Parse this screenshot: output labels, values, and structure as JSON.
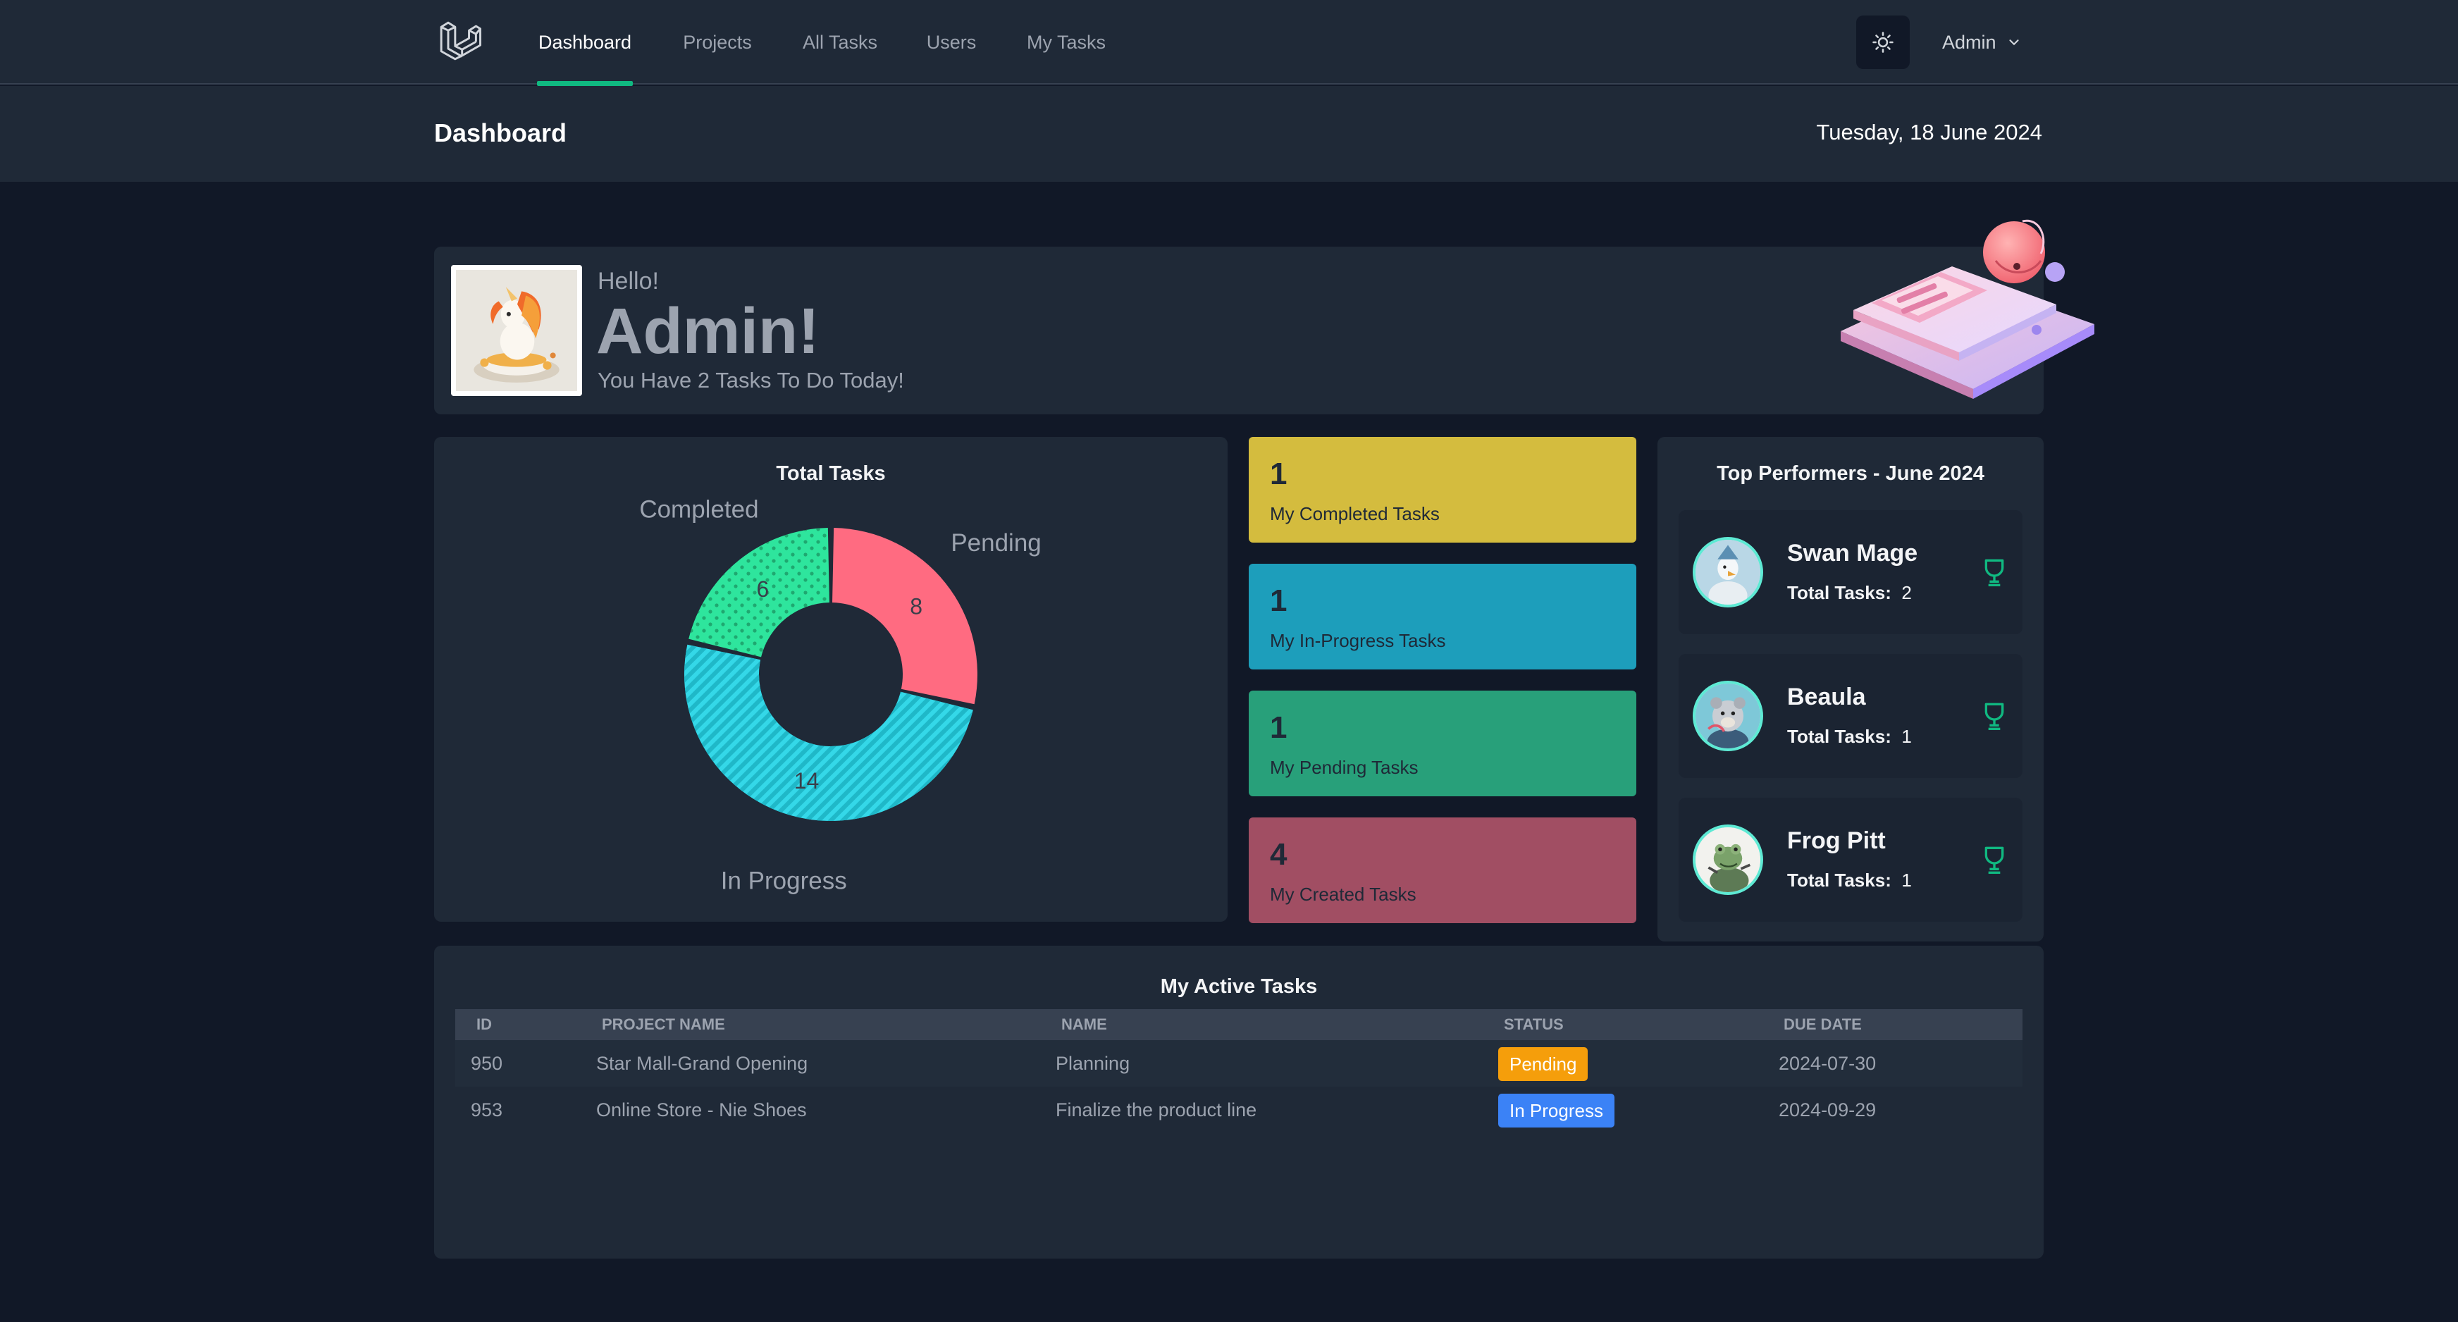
{
  "nav": {
    "items": [
      {
        "label": "Dashboard",
        "active": true
      },
      {
        "label": "Projects",
        "active": false
      },
      {
        "label": "All Tasks",
        "active": false
      },
      {
        "label": "Users",
        "active": false
      },
      {
        "label": "My Tasks",
        "active": false
      }
    ],
    "user_label": "Admin",
    "logo_icon": "laravel-logo-icon",
    "theme_icon": "sun-icon"
  },
  "header": {
    "title": "Dashboard",
    "date": "Tuesday, 18 June 2024"
  },
  "welcome": {
    "greeting": "Hello!",
    "name": "Admin!",
    "message": "You Have 2 Tasks To Do Today!"
  },
  "total_tasks": {
    "title": "Total Tasks"
  },
  "chart_data": {
    "type": "pie",
    "title": "Total Tasks",
    "slices": [
      {
        "label": "Pending",
        "value": 8,
        "color": "#ff6b81"
      },
      {
        "label": "In Progress",
        "value": 14,
        "color": "#34d8e8"
      },
      {
        "label": "Completed",
        "value": 6,
        "color": "#2ee59d"
      }
    ]
  },
  "stats": [
    {
      "count": "1",
      "label": "My Completed Tasks",
      "color": "#d4bc3e"
    },
    {
      "count": "1",
      "label": "My In-Progress Tasks",
      "color": "#1d9ebb"
    },
    {
      "count": "1",
      "label": "My Pending Tasks",
      "color": "#28a07a"
    },
    {
      "count": "4",
      "label": "My Created Tasks",
      "color": "#a14e63"
    }
  ],
  "performers": {
    "title": "Top Performers - June 2024",
    "tasks_label": "Total Tasks:",
    "items": [
      {
        "name": "Swan Mage",
        "tasks": "2"
      },
      {
        "name": "Beaula",
        "tasks": "1"
      },
      {
        "name": "Frog Pitt",
        "tasks": "1"
      }
    ]
  },
  "active_tasks": {
    "title": "My Active Tasks",
    "columns": [
      "ID",
      "PROJECT NAME",
      "NAME",
      "STATUS",
      "DUE DATE"
    ],
    "rows": [
      {
        "id": "950",
        "project": "Star Mall-Grand Opening",
        "name": "Planning",
        "status": "Pending",
        "status_color": "#f59e0b",
        "due": "2024-07-30"
      },
      {
        "id": "953",
        "project": "Online Store - Nie Shoes",
        "name": "Finalize the product line",
        "status": "In Progress",
        "status_color": "#3b82f6",
        "due": "2024-09-29"
      }
    ]
  }
}
